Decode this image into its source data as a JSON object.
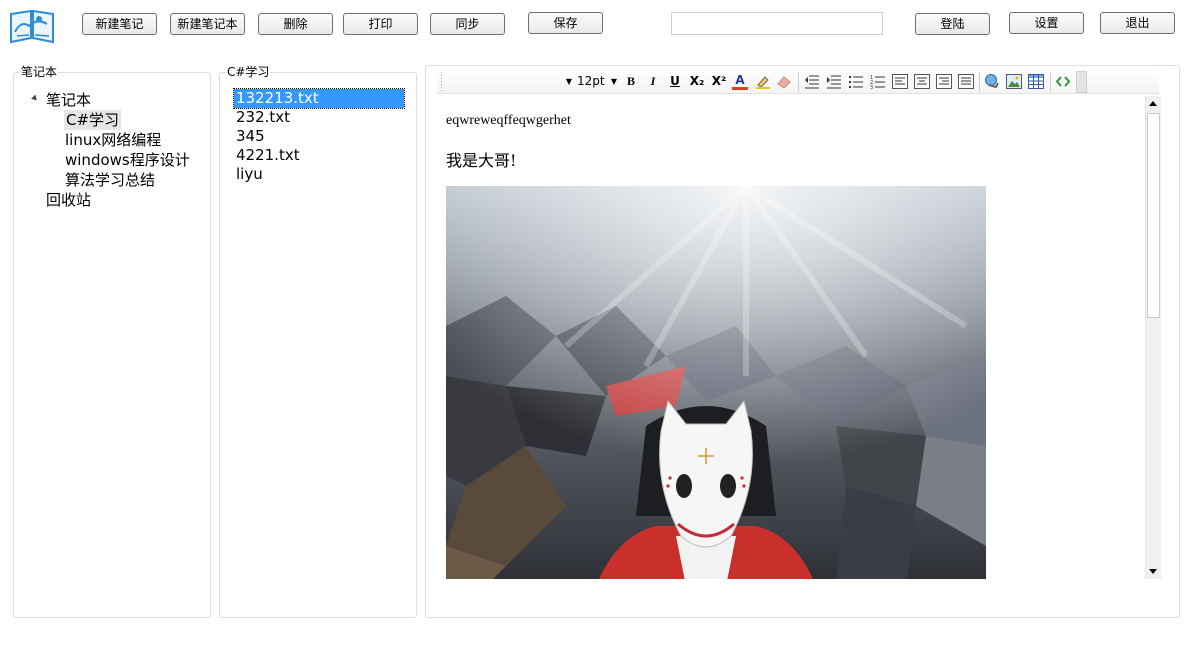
{
  "toolbar": {
    "new_note": "新建笔记",
    "new_notebook": "新建笔记本",
    "delete": "删除",
    "print": "打印",
    "sync": "同步",
    "save": "保存",
    "search_value": "",
    "login": "登陆",
    "settings": "设置",
    "exit": "退出"
  },
  "notebook_panel": {
    "title": "笔记本",
    "root": "笔记本",
    "items": [
      "C#学习",
      "linux网络编程",
      "windows程序设计",
      "算法学习总结"
    ],
    "recycle": "回收站",
    "selected_item": "C#学习"
  },
  "file_panel": {
    "title": "C#学习",
    "files": [
      "132213.txt",
      "232.txt",
      "345",
      "4221.txt",
      "liyu"
    ],
    "selected_file": "132213.txt"
  },
  "editor": {
    "font_size": "12pt",
    "font_name": "",
    "paragraph1": "eqwreweqffeqwgerhet",
    "paragraph2": "我是大哥!",
    "format_buttons": {
      "bold": "B",
      "italic": "I",
      "underline": "U",
      "subscript": "X₂",
      "superscript": "X²",
      "font_color": "A"
    }
  },
  "colors": {
    "accent_selection": "#3399ff",
    "group_border": "#d5dfe5",
    "logo_blue": "#2a8fd6"
  }
}
